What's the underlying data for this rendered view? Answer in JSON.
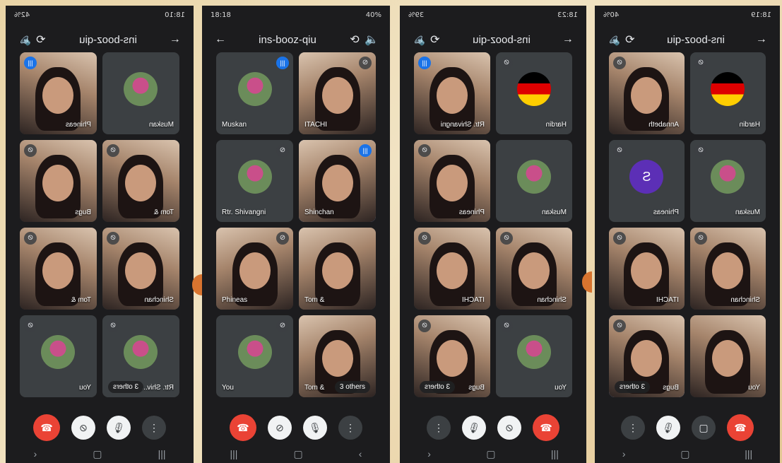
{
  "phones": [
    {
      "status_left": "18:10",
      "status_right": "42%",
      "meeting_code": "ins-booz-qiu",
      "tiles": [
        {
          "name": "Muskan",
          "kind": "avatar"
        },
        {
          "name": "Phineas",
          "kind": "video",
          "speaking": true
        },
        {
          "name": "Tom &",
          "kind": "video",
          "muted": true
        },
        {
          "name": "Bugs",
          "kind": "video",
          "muted": true
        },
        {
          "name": "Shinchan",
          "kind": "video",
          "muted": true
        },
        {
          "name": "Tom &",
          "kind": "video",
          "muted": true
        },
        {
          "name": "Rtr. Shiv...",
          "kind": "avatar",
          "muted": true,
          "others": "3 others"
        },
        {
          "name": "You",
          "kind": "avatar",
          "muted": true
        }
      ]
    },
    {
      "status_left": "18:18",
      "status_right": "40%",
      "meeting_code": "ins-booz-qiu",
      "tiles": [
        {
          "name": "Muskan",
          "kind": "avatar",
          "speaking": true
        },
        {
          "name": "ITACHI",
          "kind": "video",
          "muted": true
        },
        {
          "name": "Rtr. Shivangni",
          "kind": "avatar",
          "muted": true
        },
        {
          "name": "Shinchan",
          "kind": "video",
          "speaking": true,
          "active": true
        },
        {
          "name": "Phineas",
          "kind": "video",
          "muted": true
        },
        {
          "name": "Tom &",
          "kind": "video"
        },
        {
          "name": "You",
          "kind": "avatar",
          "muted": true
        },
        {
          "name": "Tom &",
          "kind": "video",
          "others": "3 others"
        }
      ]
    },
    {
      "status_left": "18:23",
      "status_right": "39%",
      "meeting_code": "ins-booz-qiu",
      "tiles": [
        {
          "name": "Hardin",
          "kind": "flag",
          "muted": true
        },
        {
          "name": "Rtr. Shivangni",
          "kind": "video",
          "speaking": true
        },
        {
          "name": "Muskan",
          "kind": "avatar"
        },
        {
          "name": "Phineas",
          "kind": "video",
          "muted": true
        },
        {
          "name": "Shinchan",
          "kind": "video",
          "muted": true
        },
        {
          "name": "ITACHI",
          "kind": "video",
          "muted": true
        },
        {
          "name": "You",
          "kind": "avatar",
          "muted": true
        },
        {
          "name": "Bugs",
          "kind": "video",
          "muted": true,
          "others": "3 others"
        }
      ]
    },
    {
      "status_left": "18:19",
      "status_right": "40%",
      "meeting_code": "ins-booz-qiu",
      "tiles": [
        {
          "name": "Hardin",
          "kind": "flag",
          "muted": true
        },
        {
          "name": "Annabeth",
          "kind": "video",
          "muted": true
        },
        {
          "name": "Muskan",
          "kind": "avatar",
          "muted": true
        },
        {
          "name": "Phineas",
          "kind": "letter",
          "letter": "S",
          "muted": true
        },
        {
          "name": "Shinchan",
          "kind": "video",
          "muted": true
        },
        {
          "name": "ITACHI",
          "kind": "video",
          "muted": true
        },
        {
          "name": "You",
          "kind": "video"
        },
        {
          "name": "Bugs",
          "kind": "video",
          "muted": true,
          "active": true,
          "others": "3 others"
        }
      ]
    }
  ],
  "icons": {
    "back": "arrow-left-icon",
    "forward": "arrow-right-icon",
    "speaker": "speaker-icon",
    "flip_camera": "flip-camera-icon",
    "mic_off": "mic-off-icon",
    "cam_off": "camera-off-icon",
    "end_call": "end-call-icon",
    "more": "more-vert-icon",
    "speaking": "audio-wave-icon"
  },
  "colors": {
    "end_call": "#ea4335",
    "speaking": "#1a73e8",
    "active_outline": "#8ab4f8"
  }
}
